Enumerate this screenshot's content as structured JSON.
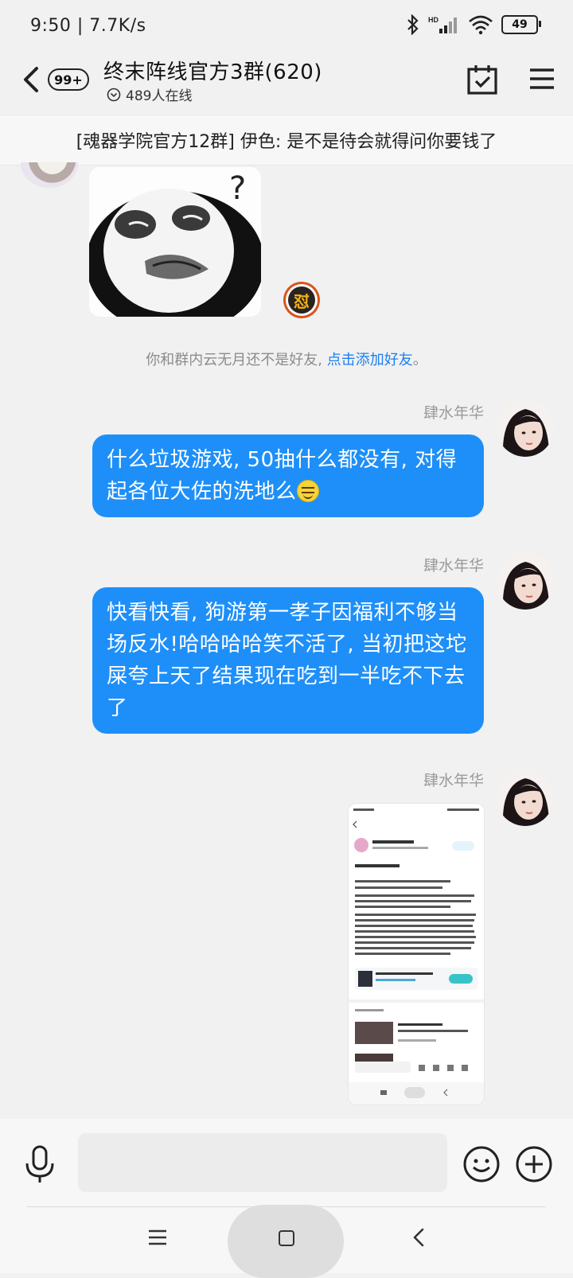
{
  "status_bar": {
    "time_speed": "9:50 | 7.7K/s",
    "battery": "49"
  },
  "header": {
    "unread_badge": "99+",
    "title": "终末阵线官方3群(620)",
    "online": "489人在线"
  },
  "notice": "[魂器学院官方12群] 伊色: 是不是待会就得问你要钱了",
  "reaction_badge": "怼",
  "system_tip": {
    "text": "你和群内云无月还不是好友, ",
    "link": "点击添加好友",
    "suffix": "。"
  },
  "messages": [
    {
      "sender": "肆水年华",
      "text": "什么垃圾游戏, 50抽什么都没有, 对得起各位大佐的洗地么"
    },
    {
      "sender": "肆水年华",
      "text": "快看快看, 狗游第一孝子因福利不够当场反水!哈哈哈哈笑不活了, 当初把这坨屎夸上天了结果现在吃到一半吃不下去了"
    },
    {
      "sender": "肆水年华",
      "type": "image"
    }
  ],
  "colors": {
    "bubble": "#1e8ff8",
    "link": "#1c7ff0",
    "background": "#f1f1f1"
  },
  "icons": [
    "back-arrow-icon",
    "calendar-check-icon",
    "menu-icon",
    "mic-icon",
    "emoji-icon",
    "plus-icon"
  ]
}
